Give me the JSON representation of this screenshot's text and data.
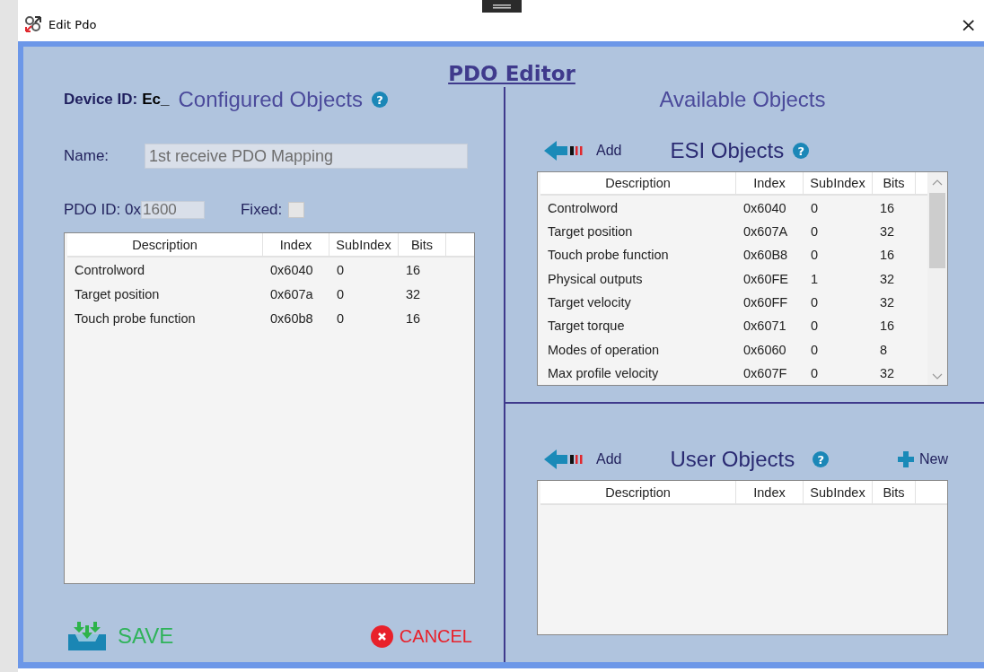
{
  "window": {
    "title": "Edit Pdo",
    "close": "×"
  },
  "heading": "PDO Editor",
  "configured": {
    "device_id_label": "Device ID:",
    "device_id": "Ec_",
    "title": "Configured Objects",
    "help": "?",
    "name": {
      "label": "Name:",
      "value": "1st receive PDO Mapping",
      "disabled": true
    },
    "pdo_id": {
      "label": "PDO ID: 0x",
      "value": "1600",
      "disabled": true
    },
    "fixed": {
      "label": "Fixed:",
      "checked": false
    },
    "table": {
      "columns": [
        "Description",
        "Index",
        "SubIndex",
        "Bits"
      ],
      "rows": [
        [
          "Controlword",
          "0x6040",
          "0",
          "16"
        ],
        [
          "Target position",
          "0x607a",
          "0",
          "32"
        ],
        [
          "Touch probe function",
          "0x60b8",
          "0",
          "16"
        ]
      ]
    }
  },
  "available": {
    "title": "Available Objects",
    "esi": {
      "add": "Add",
      "title": "ESI Objects",
      "help": "?",
      "table": {
        "columns": [
          "Description",
          "Index",
          "SubIndex",
          "Bits"
        ],
        "rows": [
          [
            "Controlword",
            "0x6040",
            "0",
            "16"
          ],
          [
            "Target position",
            "0x607A",
            "0",
            "32"
          ],
          [
            "Touch probe function",
            "0x60B8",
            "0",
            "16"
          ],
          [
            "Physical outputs",
            "0x60FE",
            "1",
            "32"
          ],
          [
            "Target velocity",
            "0x60FF",
            "0",
            "32"
          ],
          [
            "Target torque",
            "0x6071",
            "0",
            "16"
          ],
          [
            "Modes of operation",
            "0x6060",
            "0",
            "8"
          ],
          [
            "Max profile velocity",
            "0x607F",
            "0",
            "32"
          ]
        ]
      }
    },
    "user": {
      "add": "Add",
      "title": "User Objects",
      "help": "?",
      "new": "New",
      "table": {
        "columns": [
          "Description",
          "Index",
          "SubIndex",
          "Bits"
        ]
      }
    }
  },
  "buttons": {
    "save": "SAVE",
    "cancel": "CANCEL"
  }
}
